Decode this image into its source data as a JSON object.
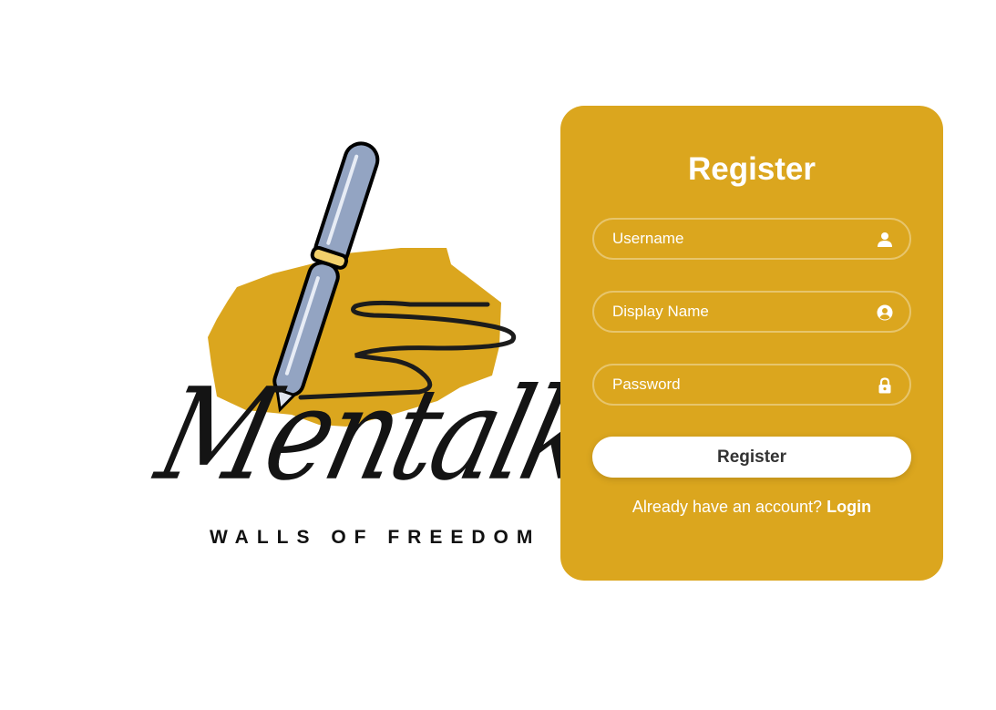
{
  "logo": {
    "wordmark": "Mentalk",
    "tagline": "WALLS OF FREEDOM"
  },
  "register_card": {
    "title": "Register",
    "username": {
      "placeholder": "Username",
      "value": "",
      "icon": "user-icon"
    },
    "display_name": {
      "placeholder": "Display Name",
      "value": "",
      "icon": "user-circle-icon"
    },
    "password": {
      "placeholder": "Password",
      "value": "",
      "icon": "lock-icon"
    },
    "submit_label": "Register",
    "footer_text": "Already have an account?",
    "login_link": "Login"
  },
  "colors": {
    "accent": "#dba61e",
    "pen_body": "#93a4c2",
    "pen_ring": "#f2d06b",
    "ink": "#141414"
  }
}
